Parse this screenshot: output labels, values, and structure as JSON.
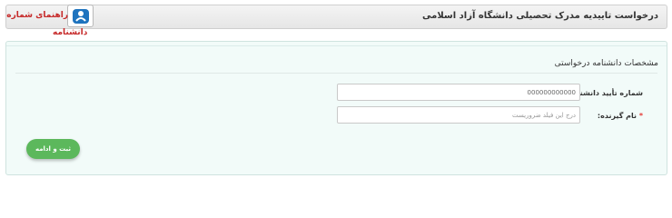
{
  "header": {
    "title": "درخواست تاییدیه مدرک تحصیلی دانشگاه آزاد اسلامی",
    "guide_link_line1": "راهنمای شماره",
    "guide_link_line2": "دانشنامه"
  },
  "form": {
    "section_title": "مشخصات دانشنامه درخواستی",
    "certificate_number": {
      "label": "شماره تأیید دانشنامه",
      "value": "000000000000"
    },
    "recipient_name": {
      "label": "نام گیرنده:",
      "required_mark": "*",
      "placeholder": "درج این فیلد ضروریست"
    },
    "submit_label": "ثبت و ادامه"
  },
  "colors": {
    "submit_green": "#5cb85c",
    "guide_link_red": "#c62828",
    "required_red": "#e53935",
    "icon_blue": "#1e73be"
  },
  "icons": {
    "guide": "help-guide-icon"
  }
}
